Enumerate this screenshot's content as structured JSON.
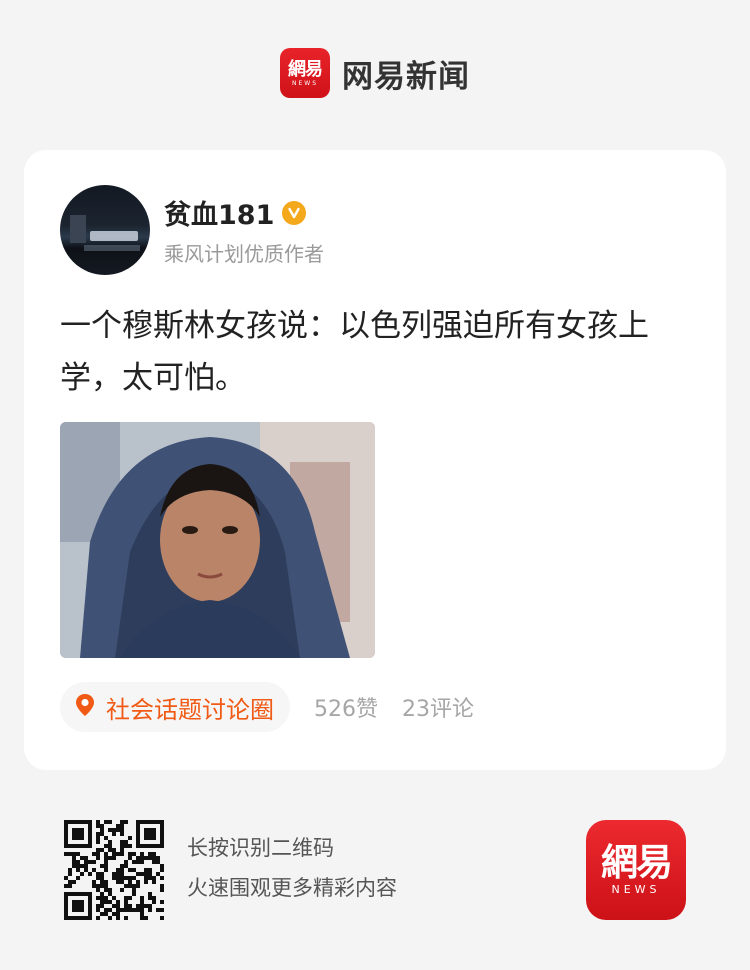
{
  "brand": {
    "logo_text": "網易",
    "logo_subtext": "NEWS",
    "name": "网易新闻"
  },
  "author": {
    "name": "贫血181",
    "title": "乘风计划优质作者"
  },
  "post": {
    "text": "一个穆斯林女孩说：以色列强迫所有女孩上学，太可怕。"
  },
  "topic": {
    "label": "社会话题讨论圈"
  },
  "stats": {
    "likes": "526赞",
    "comments": "23评论"
  },
  "cta": {
    "line1": "长按识别二维码",
    "line2": "火速围观更多精彩内容"
  },
  "colors": {
    "brand_red": "#e31c23",
    "accent_orange": "#f05a14",
    "verified_gold": "#f4a81c"
  },
  "icons": [
    "verified-icon",
    "location-pin-icon",
    "qr-code-icon"
  ]
}
